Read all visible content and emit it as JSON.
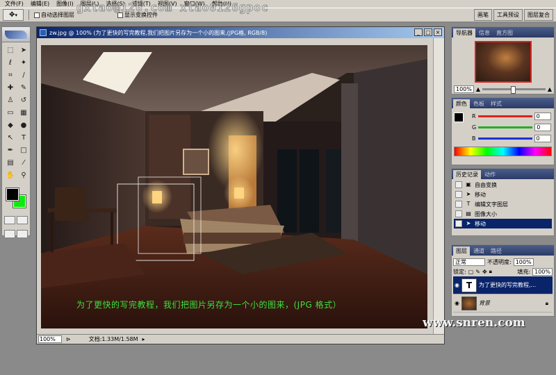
{
  "menubar": {
    "items": [
      "文件(F)",
      "编辑(E)",
      "图像(I)",
      "图层(L)",
      "选择(S)",
      "滤镜(T)",
      "视图(V)",
      "窗口(W)",
      "帮助(H)"
    ]
  },
  "options": {
    "auto_select_label": "自动选择图层",
    "show_bounds_label": "显示变换控件",
    "watermark": "gxtao@126.com xtao0126gpoc"
  },
  "well": {
    "tabs": [
      "画笔",
      "工具预设",
      "图层复合"
    ]
  },
  "document": {
    "title": "zw.jpg @ 100% (为了更快的写完教程,我们把图片另存为一个小的图来,(JPG格, RGB/8)",
    "caption": "为了更快的写完教程，我们把图片另存为一个小的图来，(JPG 格式）",
    "zoom": "100%",
    "doc_size": "文档:1.33M/1.58M",
    "site_watermark": "www.snren.com"
  },
  "navigator": {
    "tabs": [
      "导航器",
      "信息",
      "直方图"
    ],
    "zoom": "100%"
  },
  "color_panel": {
    "tabs": [
      "颜色",
      "色板",
      "样式"
    ],
    "rows": [
      {
        "label": "R",
        "value": "0",
        "color": "#e02020"
      },
      {
        "label": "G",
        "value": "0",
        "color": "#20b020"
      },
      {
        "label": "B",
        "value": "0",
        "color": "#2030d0"
      }
    ]
  },
  "history": {
    "tabs": [
      "历史记录",
      "动作"
    ],
    "items": [
      {
        "icon": "free-transform-icon",
        "label": "自由变换"
      },
      {
        "icon": "move-icon",
        "label": "移动"
      },
      {
        "icon": "text-icon",
        "label": "编辑文字图层"
      },
      {
        "icon": "image-size-icon",
        "label": "图像大小"
      },
      {
        "icon": "move-icon",
        "label": "移动"
      }
    ]
  },
  "layers": {
    "tabs": [
      "图层",
      "通道",
      "路径"
    ],
    "blend_mode": "正常",
    "opacity_label": "不透明度:",
    "opacity": "100%",
    "lock_label": "锁定:",
    "fill_label": "填充:",
    "fill": "100%",
    "items": [
      {
        "name": "为了更快的写完教程,...",
        "type": "text"
      },
      {
        "name": "背景",
        "type": "image"
      }
    ]
  },
  "colors": {
    "foreground": "#000000",
    "background": "#10e810",
    "titlebar": "#0a246a"
  }
}
